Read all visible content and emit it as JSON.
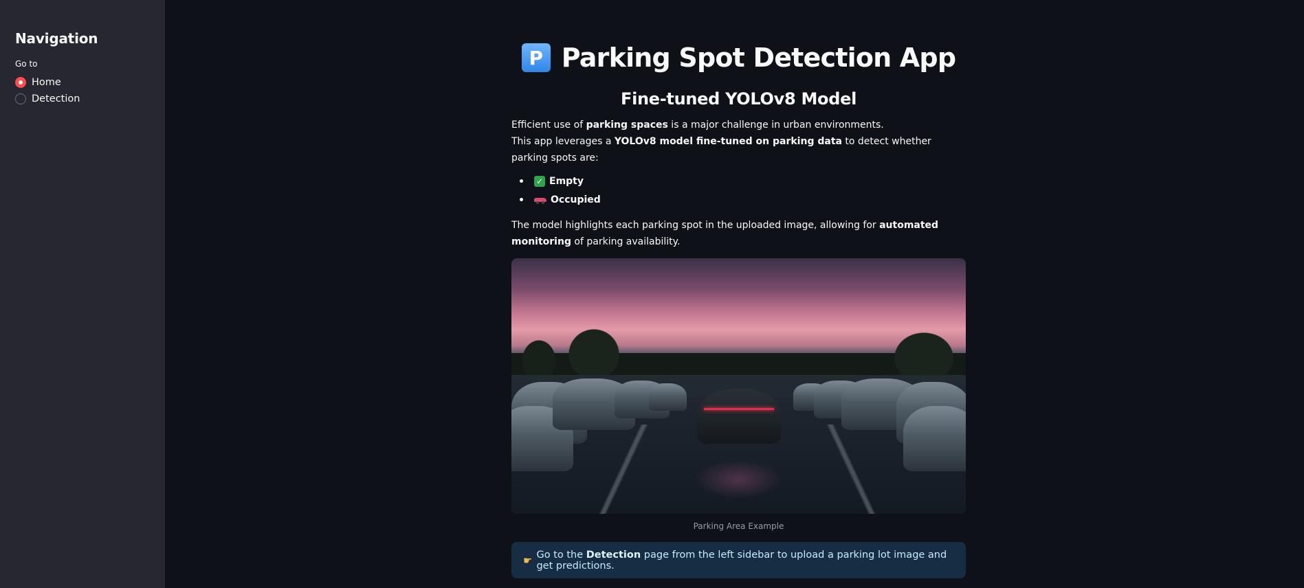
{
  "sidebar": {
    "heading": "Navigation",
    "radio_label": "Go to",
    "options": [
      {
        "label": "Home",
        "selected": true
      },
      {
        "label": "Detection",
        "selected": false
      }
    ]
  },
  "main": {
    "title_icon": "P",
    "title": "Parking Spot Detection App",
    "subtitle": "Fine-tuned YOLOv8 Model",
    "intro": {
      "l1_a": "Efficient use of ",
      "l1_b": "parking spaces",
      "l1_c": " is a major challenge in urban environments.",
      "l2_a": "This app leverages a ",
      "l2_b": "YOLOv8 model fine-tuned on parking data",
      "l2_c": " to detect whether parking spots are:"
    },
    "bullets": [
      {
        "icon": "check-mark-icon",
        "label": "Empty"
      },
      {
        "icon": "car-icon",
        "label": "Occupied"
      }
    ],
    "description": {
      "a": "The model highlights each parking spot in the uploaded image, allowing for ",
      "b": "automated monitoring",
      "c": " of parking availability."
    },
    "image_caption": "Parking Area Example",
    "info": {
      "icon": "pointing-hand-icon",
      "a": "Go to the ",
      "b": "Detection",
      "c": " page from the left sidebar to upload a parking lot image and get predictions."
    }
  },
  "colors": {
    "accent": "#ff4b4b",
    "background": "#0e1117",
    "sidebar": "#262730",
    "info_bg": "#172d43",
    "info_text": "#c7ebff"
  }
}
